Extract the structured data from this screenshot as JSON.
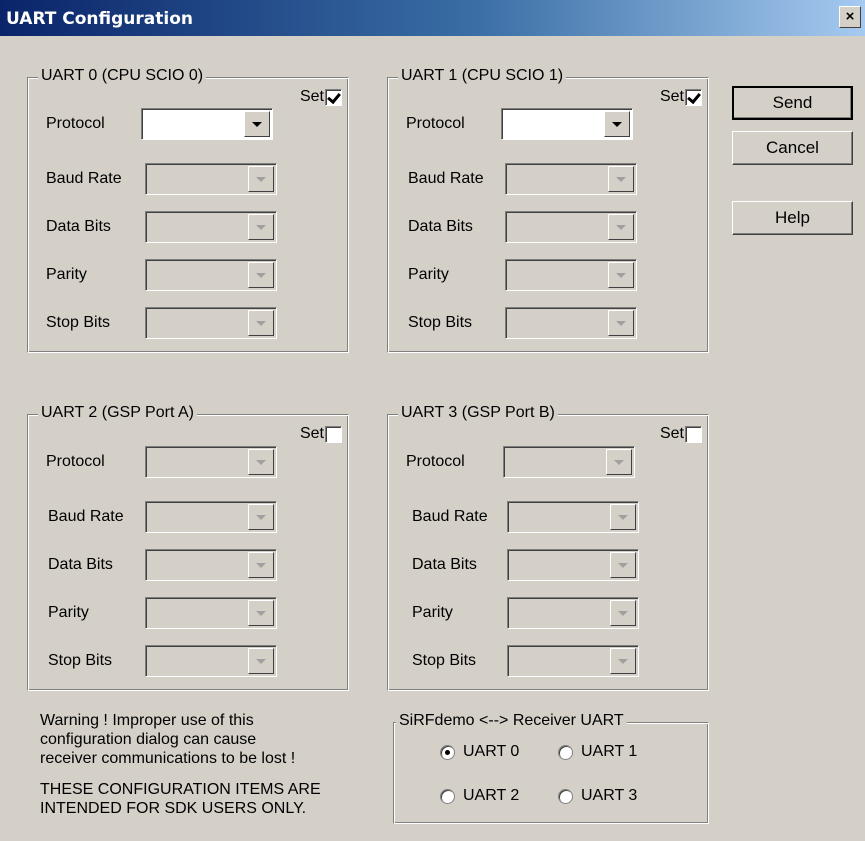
{
  "window": {
    "title": "UART Configuration",
    "close_glyph": "×"
  },
  "uart0": {
    "title": "UART 0 (CPU SCIO 0)",
    "set_label": "Set",
    "set_checked": true,
    "fields": {
      "protocol": "Protocol",
      "baud": "Baud Rate",
      "data": "Data Bits",
      "parity": "Parity",
      "stop": "Stop Bits"
    }
  },
  "uart1": {
    "title": "UART 1 (CPU SCIO 1)",
    "set_label": "Set",
    "set_checked": true,
    "fields": {
      "protocol": "Protocol",
      "baud": "Baud Rate",
      "data": "Data Bits",
      "parity": "Parity",
      "stop": "Stop Bits"
    }
  },
  "uart2": {
    "title": "UART 2 (GSP Port A)",
    "set_label": "Set",
    "set_checked": false,
    "fields": {
      "protocol": "Protocol",
      "baud": "Baud Rate",
      "data": "Data Bits",
      "parity": "Parity",
      "stop": "Stop Bits"
    }
  },
  "uart3": {
    "title": "UART 3 (GSP Port B)",
    "set_label": "Set",
    "set_checked": false,
    "fields": {
      "protocol": "Protocol",
      "baud": "Baud Rate",
      "data": "Data Bits",
      "parity": "Parity",
      "stop": "Stop Bits"
    }
  },
  "buttons": {
    "send": "Send",
    "cancel": "Cancel",
    "help": "Help"
  },
  "warning": {
    "line1": "Warning !  Improper use of this",
    "line2": "configuration dialog can cause",
    "line3": "receiver communications to be lost !",
    "line4": "THESE CONFIGURATION ITEMS ARE",
    "line5": "INTENDED FOR SDK USERS ONLY."
  },
  "receiver_uart": {
    "title": "SiRFdemo <--> Receiver UART",
    "options": [
      "UART 0",
      "UART 1",
      "UART 2",
      "UART 3"
    ],
    "selected": "UART 0"
  },
  "icons": {
    "close": "close-icon",
    "dropdown": "chevron-down-icon"
  }
}
